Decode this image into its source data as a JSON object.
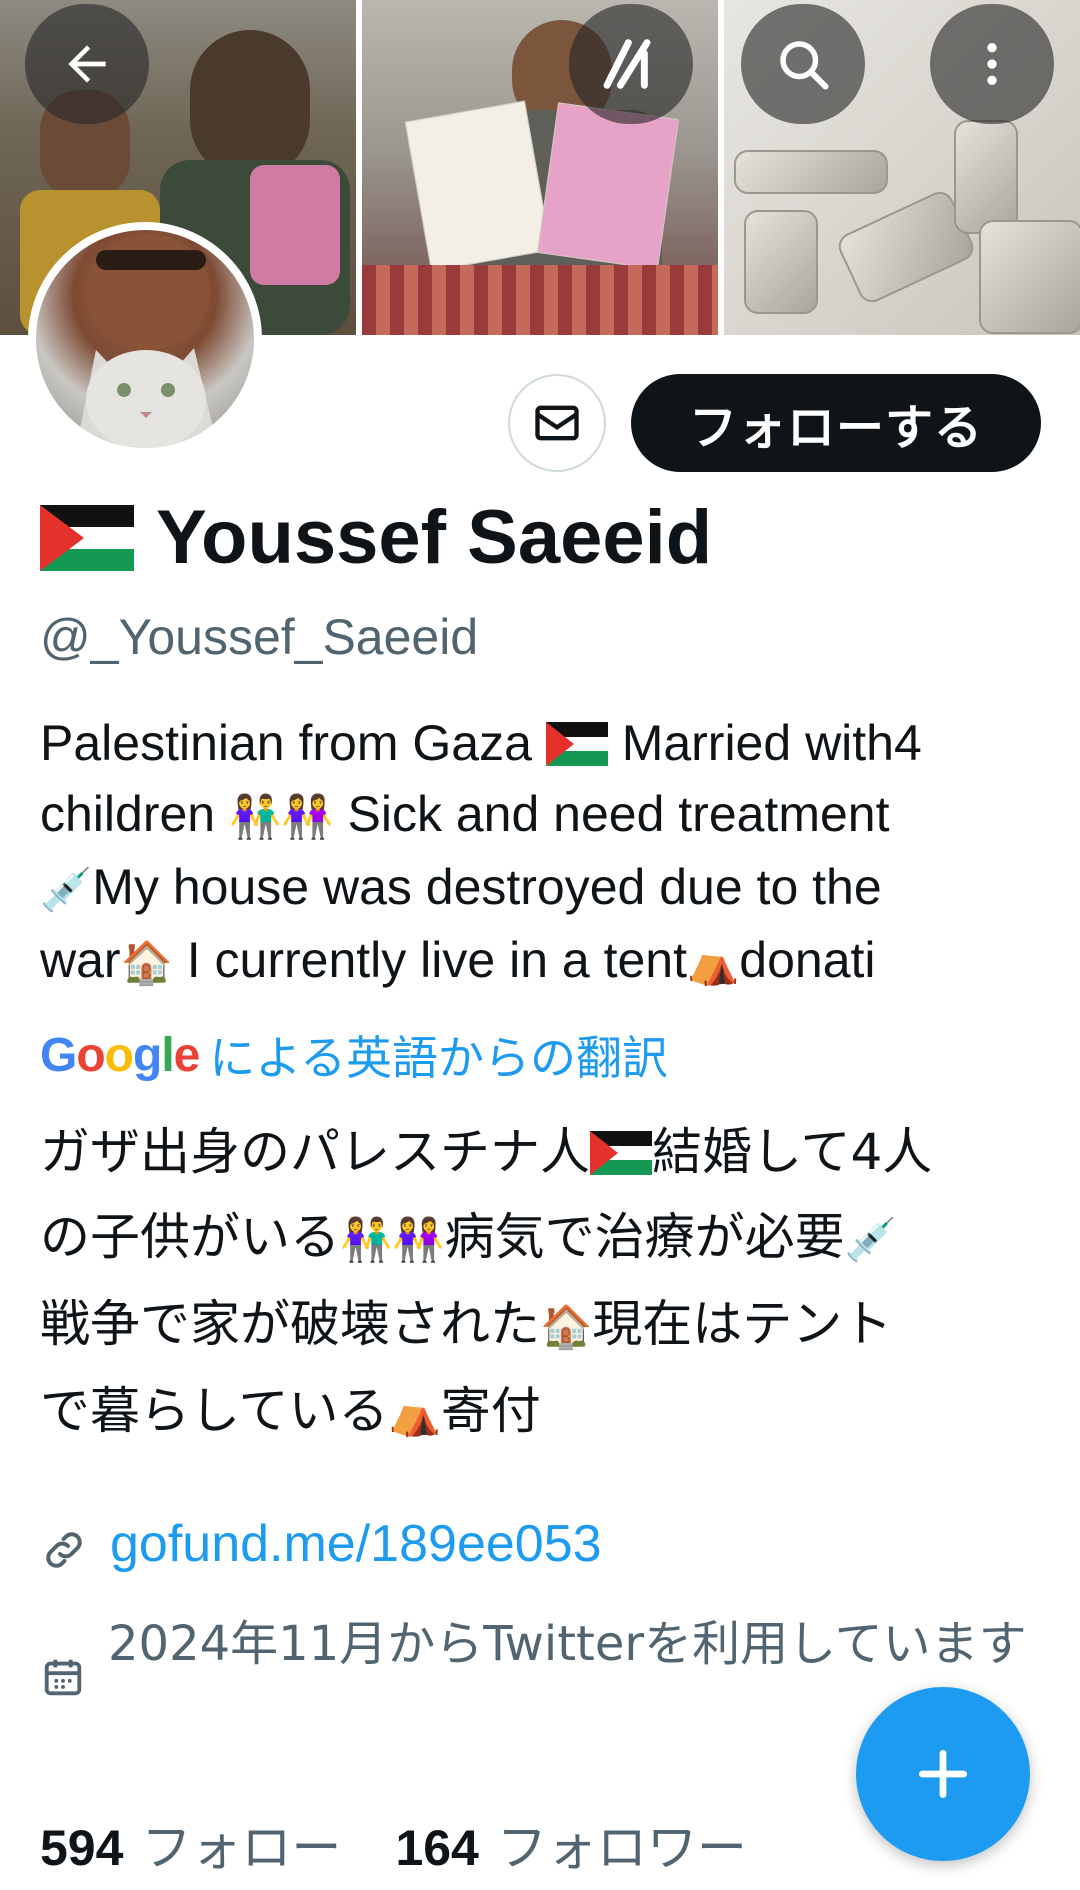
{
  "header": {
    "back_label": "Back",
    "grok_label": "Grok",
    "search_label": "Search",
    "more_label": "More"
  },
  "profile": {
    "name": "Youssef Saeeid",
    "handle": "@_Youssef_Saeeid",
    "follow_label": "フォローする",
    "message_label": "Message"
  },
  "bio": {
    "line1_a": "Palestinian from Gaza ",
    "line1_b": " Married with4",
    "line2_a": "children ",
    "line2_b": " Sick and need treatment",
    "line3": "My house was destroyed due to the",
    "line4_a": "war",
    "line4_b": " I currently live in a tent",
    "line4_c": "donati"
  },
  "translation": {
    "google_logo": "Google",
    "label": "による英語からの翻訳",
    "line1_a": "ガザ出身のパレスチナ人",
    "line1_b": "結婚して4人",
    "line2_a": "の子供がいる",
    "line2_b": "病気で治療が必要",
    "line3_a": "戦争で家が破壊された",
    "line3_b": "現在はテント",
    "line4_a": "で暮らしている",
    "line4_b": "寄付"
  },
  "meta": {
    "link": "gofund.me/189ee053",
    "joined": "2024年11月からTwitterを利用しています"
  },
  "counts": {
    "following_count": "594",
    "following_label": "フォロー",
    "followers_count": "164",
    "followers_label": "フォロワー"
  },
  "fab": {
    "label": "Compose"
  },
  "colors": {
    "accent": "#1d9bf0",
    "text": "#0f1419",
    "secondary": "#536471",
    "follow_button": "#0f1419"
  },
  "icons": [
    "back-arrow-icon",
    "grok-icon",
    "search-icon",
    "more-vertical-icon",
    "mail-icon",
    "link-icon",
    "calendar-icon",
    "plus-icon",
    "palestine-flag-icon",
    "people-icon",
    "syringe-icon",
    "house-icon",
    "tent-icon"
  ]
}
